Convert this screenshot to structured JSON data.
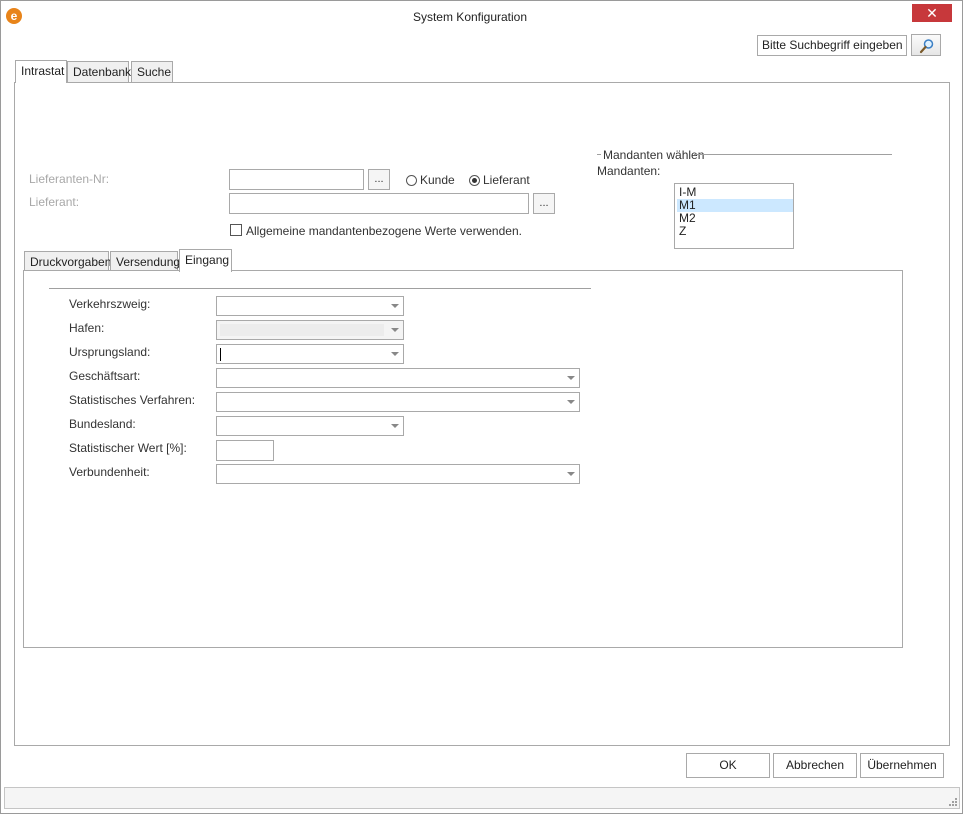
{
  "window": {
    "title": "System Konfiguration",
    "close": "✕",
    "app_icon": "e-logo"
  },
  "search": {
    "placeholder": "Bitte Suchbegriff eingeben",
    "value": "Bitte Suchbegriff eingeben",
    "icon": "magnifier-icon"
  },
  "tabs_top": [
    "Intrastat",
    "Datenbank",
    "Suche"
  ],
  "form": {
    "lieferanten_nr_label": "Lieferanten-Nr:",
    "lieferant_label": "Lieferant:",
    "dots": "...",
    "radio_kunde": "Kunde",
    "radio_lieferant": "Lieferant",
    "selected_radio": "Lieferant",
    "checkbox_label": "Allgemeine mandantenbezogene Werte verwenden."
  },
  "mandanten": {
    "group_title": "Mandanten wählen",
    "label": "Mandanten:",
    "items": [
      "I-M",
      "M1",
      "M2",
      "Z"
    ],
    "selected": "M1"
  },
  "tabs_inner": [
    "Druckvorgaben",
    "Versendung",
    "Eingang"
  ],
  "eingang": {
    "verkehrszweig": "Verkehrszweig:",
    "hafen": "Hafen:",
    "ursprungsland": "Ursprungsland:",
    "geschaeftsart": "Geschäftsart:",
    "statistisches_verfahren": "Statistisches Verfahren:",
    "bundesland": "Bundesland:",
    "statistischer_wert": "Statistischer Wert [%]:",
    "verbundenheit": "Verbundenheit:"
  },
  "buttons": {
    "ok": "OK",
    "abbrechen": "Abbrechen",
    "uebernehmen": "Übernehmen"
  }
}
